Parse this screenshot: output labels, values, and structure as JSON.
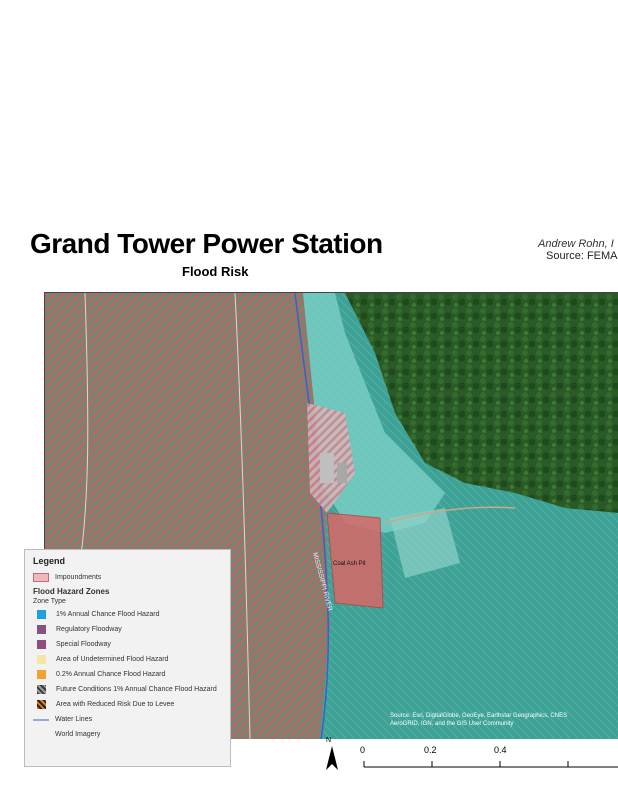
{
  "header": {
    "title": "Grand Tower Power Station",
    "subtitle": "Flood Risk",
    "author": "Andrew Rohn, I",
    "source": "Source: FEMA"
  },
  "map": {
    "river_label": "MISSISSIPPI RIVER",
    "impoundment_label": "Coal Ash Pit",
    "credits_line1": "Source: Esri, DigitalGlobe, GeoEye, Earthstar Geographics, CNES",
    "credits_line2": "AeroGRID, IGN, and the GIS User Community"
  },
  "legend": {
    "title": "Legend",
    "impoundment_item": "Impoundments",
    "section": "Flood Hazard Zones",
    "subsection": "Zone Type",
    "items": [
      {
        "label": "1% Annual Chance Flood Hazard",
        "color": "#1e9fe0"
      },
      {
        "label": "Regulatory Floodway",
        "color": "#cc3b3b"
      },
      {
        "label": "Special Floodway",
        "color": "#4a63c4"
      },
      {
        "label": "Area of Undetermined Flood Hazard",
        "color": "#f5e6a8"
      },
      {
        "label": "0.2% Annual Chance Flood Hazard",
        "color": "#f5a030"
      },
      {
        "label": "Future Conditions 1% Annual Chance Flood Hazard",
        "color": "#6b6b6b"
      },
      {
        "label": "Area with Reduced Risk Due to Levee",
        "color": "#f07c1a"
      }
    ],
    "water_lines": "Water Lines",
    "imagery": "World Imagery"
  },
  "scale": {
    "north": "N",
    "labels": [
      "0",
      "0.2",
      "0.4"
    ]
  }
}
